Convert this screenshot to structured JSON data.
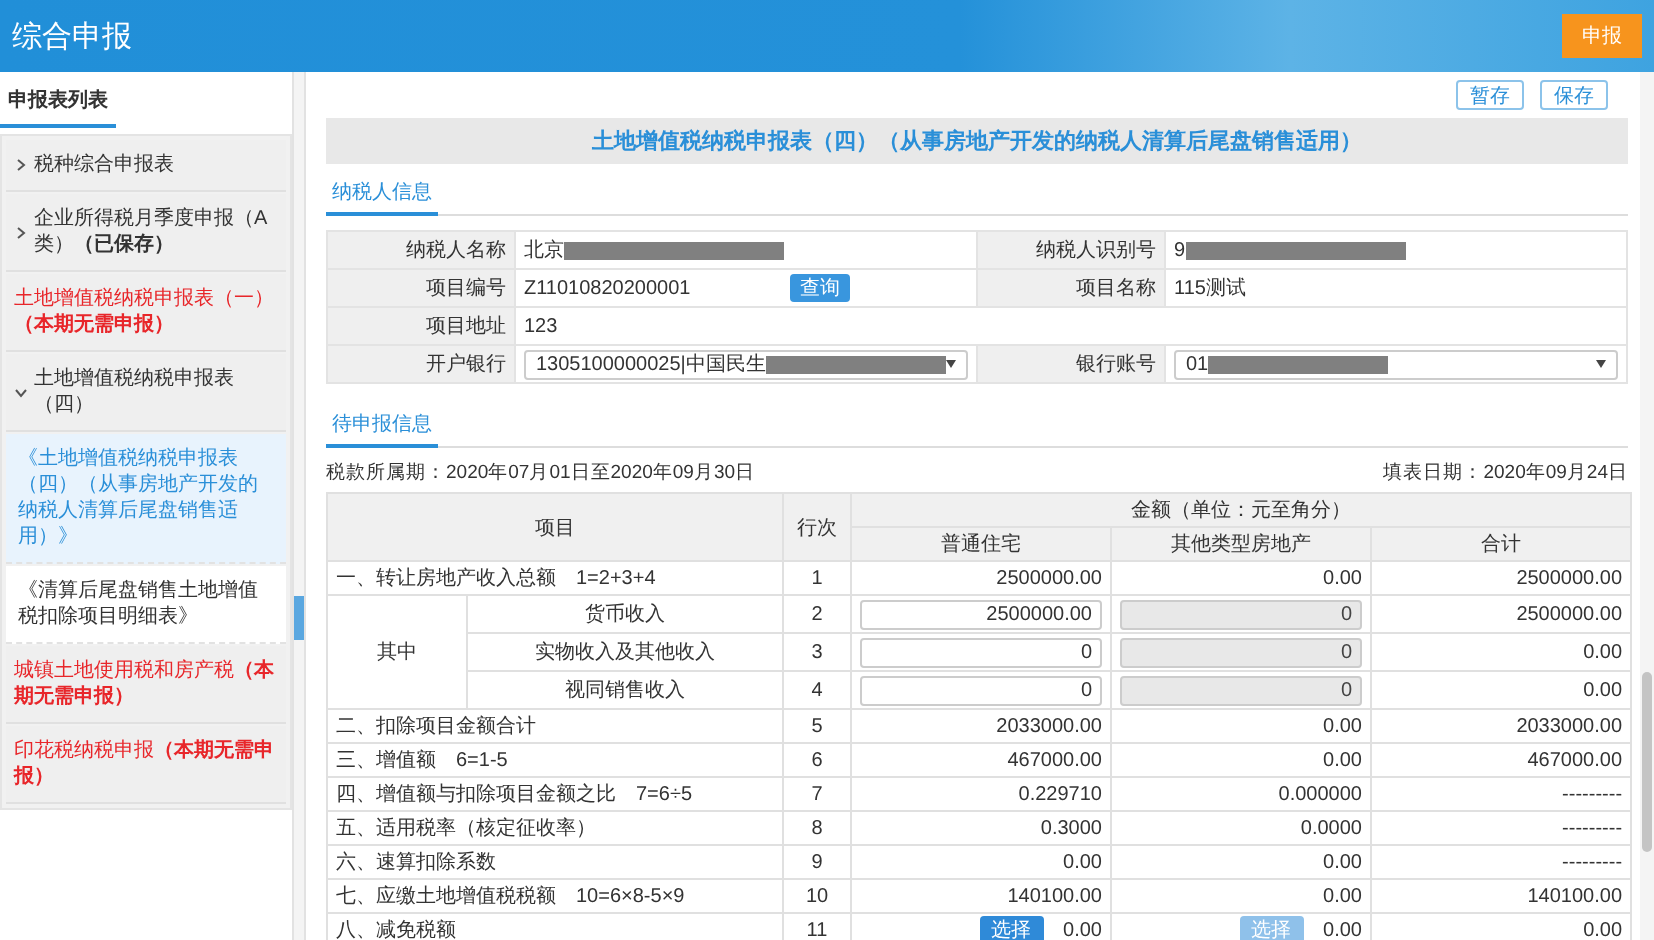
{
  "header": {
    "title": "综合申报",
    "button": "申报"
  },
  "sidebar": {
    "heading": "申报表列表",
    "items": [
      {
        "kind": "expandable",
        "label": "税种综合申报表",
        "expanded": false
      },
      {
        "kind": "expandable",
        "label": "企业所得税月季度申报（A类）",
        "status": "（已保存）",
        "expanded": false
      },
      {
        "kind": "notice",
        "label": "土地增值税纳税申报表（一）",
        "status": "（本期无需申报）"
      },
      {
        "kind": "expandable",
        "label": "土地增值税纳税申报表（四）",
        "expanded": true,
        "children": [
          {
            "label": "《土地增值税纳税申报表（四）（从事房地产开发的纳税人清算后尾盘销售适用）》",
            "selected": true
          },
          {
            "label": "《清算后尾盘销售土地增值税扣除项目明细表》",
            "selected": false
          }
        ]
      },
      {
        "kind": "notice",
        "label": "城镇土地使用税和房产税",
        "status": "（本期无需申报）"
      },
      {
        "kind": "notice",
        "label": "印花税纳税申报",
        "status": "（本期无需申报）"
      }
    ]
  },
  "toolbar": {
    "buttons": [
      "暂存",
      "保存"
    ]
  },
  "form": {
    "title": "土地增值税纳税申报表（四）（从事房地产开发的纳税人清算后尾盘销售适用）",
    "taxpayer_section": "纳税人信息",
    "taxpayer_rows": [
      [
        {
          "kind": "text",
          "label": "纳税人名称",
          "value": "北京",
          "redacted": true
        },
        {
          "kind": "text",
          "label": "纳税人识别号",
          "value": "9",
          "redacted": true
        }
      ],
      [
        {
          "kind": "lookup",
          "label": "项目编号",
          "value": "Z11010820200001",
          "button": "查询",
          "redacted": false
        },
        {
          "kind": "text",
          "label": "项目名称",
          "value": "115测试",
          "redacted": false
        }
      ],
      [
        {
          "kind": "text",
          "label": "项目地址",
          "value": "123",
          "redacted": false
        }
      ],
      [
        {
          "kind": "select",
          "label": "开户银行",
          "value": "1305100000025|中国民生",
          "redacted": true
        },
        {
          "kind": "select",
          "label": "银行账号",
          "value": "01",
          "redacted": true
        }
      ]
    ],
    "declaration_section": "待申报信息",
    "period": "税款所属期：2020年07月01日至2020年09月30日",
    "fill_date": "填表日期：2020年09月24日",
    "table": {
      "columns": {
        "item": "项目",
        "line": "行次",
        "amount": "金额（单位：元至角分）",
        "sub": [
          "普通住宅",
          "其他类型房地产",
          "合计"
        ]
      },
      "rows": [
        {
          "kind": "row",
          "item": "一、转让房地产收入总额",
          "formula": "1=2+3+4",
          "line": "1",
          "cells": [
            {
              "kind": "text",
              "value": "2500000.00"
            },
            {
              "kind": "text",
              "value": "0.00"
            },
            {
              "kind": "text",
              "value": "2500000.00"
            }
          ]
        },
        {
          "kind": "group",
          "label": "其中",
          "rows": [
            {
              "item": "货币收入",
              "line": "2",
              "cells": [
                {
                  "kind": "input",
                  "value": "2500000.00",
                  "disabled": false
                },
                {
                  "kind": "input",
                  "value": "0",
                  "disabled": true
                },
                {
                  "kind": "text",
                  "value": "2500000.00"
                }
              ]
            },
            {
              "item": "实物收入及其他收入",
              "line": "3",
              "cells": [
                {
                  "kind": "input",
                  "value": "0",
                  "disabled": false
                },
                {
                  "kind": "input",
                  "value": "0",
                  "disabled": true
                },
                {
                  "kind": "text",
                  "value": "0.00"
                }
              ]
            },
            {
              "item": "视同销售收入",
              "line": "4",
              "cells": [
                {
                  "kind": "input",
                  "value": "0",
                  "disabled": false
                },
                {
                  "kind": "input",
                  "value": "0",
                  "disabled": true
                },
                {
                  "kind": "text",
                  "value": "0.00"
                }
              ]
            }
          ]
        },
        {
          "kind": "row",
          "item": "二、扣除项目金额合计",
          "line": "5",
          "cells": [
            {
              "kind": "text",
              "value": "2033000.00"
            },
            {
              "kind": "text",
              "value": "0.00"
            },
            {
              "kind": "text",
              "value": "2033000.00"
            }
          ]
        },
        {
          "kind": "row",
          "item": "三、增值额",
          "formula": "6=1-5",
          "line": "6",
          "cells": [
            {
              "kind": "text",
              "value": "467000.00"
            },
            {
              "kind": "text",
              "value": "0.00"
            },
            {
              "kind": "text",
              "value": "467000.00"
            }
          ]
        },
        {
          "kind": "row",
          "item": "四、增值额与扣除项目金额之比",
          "formula": "7=6÷5",
          "line": "7",
          "cells": [
            {
              "kind": "text",
              "value": "0.229710"
            },
            {
              "kind": "text",
              "value": "0.000000"
            },
            {
              "kind": "text",
              "value": "---------"
            }
          ]
        },
        {
          "kind": "row",
          "item": "五、适用税率（核定征收率）",
          "line": "8",
          "cells": [
            {
              "kind": "text",
              "value": "0.3000"
            },
            {
              "kind": "text",
              "value": "0.0000"
            },
            {
              "kind": "text",
              "value": "---------"
            }
          ]
        },
        {
          "kind": "row",
          "item": "六、速算扣除系数",
          "line": "9",
          "cells": [
            {
              "kind": "text",
              "value": "0.00"
            },
            {
              "kind": "text",
              "value": "0.00"
            },
            {
              "kind": "text",
              "value": "---------"
            }
          ]
        },
        {
          "kind": "row",
          "item": "七、应缴土地增值税税额",
          "formula": "10=6×8-5×9",
          "line": "10",
          "cells": [
            {
              "kind": "text",
              "value": "140100.00"
            },
            {
              "kind": "text",
              "value": "0.00"
            },
            {
              "kind": "text",
              "value": "140100.00"
            }
          ]
        },
        {
          "kind": "row",
          "item": "八、减免税额",
          "line": "11",
          "cells": [
            {
              "kind": "pick",
              "button": "选择",
              "value": "0.00",
              "disabled": false
            },
            {
              "kind": "pick",
              "button": "选择",
              "value": "0.00",
              "disabled": true
            },
            {
              "kind": "text",
              "value": "0.00"
            }
          ]
        }
      ]
    }
  }
}
